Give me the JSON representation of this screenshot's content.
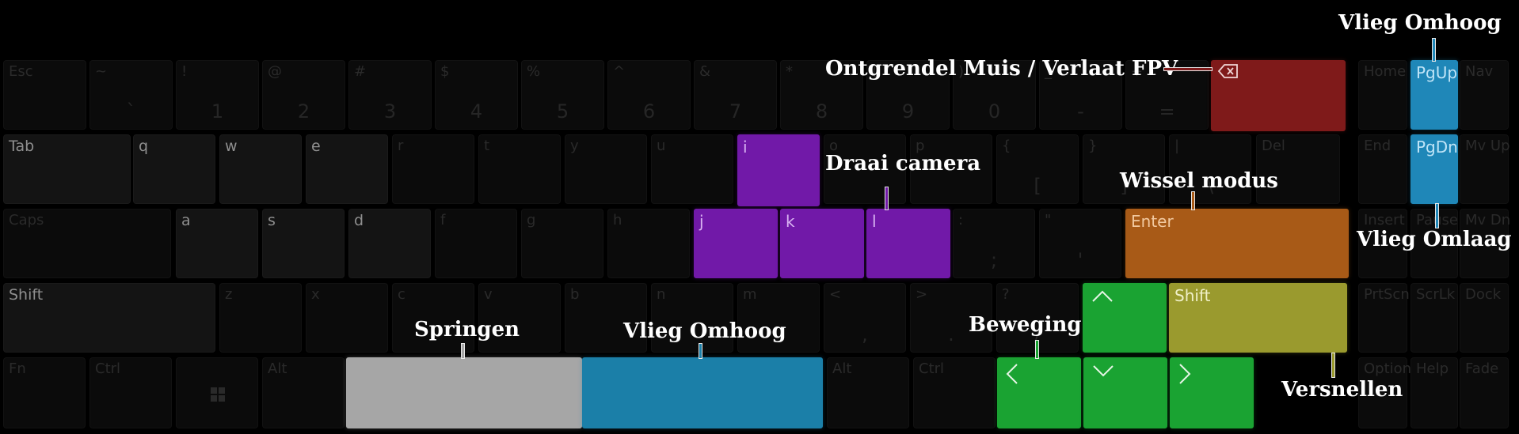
{
  "keyboard": {
    "rows": [
      [
        {
          "id": "esc",
          "top": "Esc"
        },
        {
          "id": "backtick",
          "top": "~",
          "bottom": "`"
        },
        {
          "id": "1",
          "top": "!",
          "bottom": "1"
        },
        {
          "id": "2",
          "top": "@",
          "bottom": "2"
        },
        {
          "id": "3",
          "top": "#",
          "bottom": "3"
        },
        {
          "id": "4",
          "top": "$",
          "bottom": "4"
        },
        {
          "id": "5",
          "top": "%",
          "bottom": "5"
        },
        {
          "id": "6",
          "top": "^",
          "bottom": "6"
        },
        {
          "id": "7",
          "top": "&",
          "bottom": "7"
        },
        {
          "id": "8",
          "top": "*",
          "bottom": "8"
        },
        {
          "id": "9",
          "top": "(",
          "bottom": "9"
        },
        {
          "id": "0",
          "top": ")",
          "bottom": "0"
        },
        {
          "id": "minus",
          "top": "_",
          "bottom": "-"
        },
        {
          "id": "equals",
          "top": "+",
          "bottom": "="
        },
        {
          "id": "backspace",
          "icon": "backspace-icon",
          "lit": true,
          "color": "#7f1a1a"
        },
        {
          "id": "home",
          "top": "Home"
        },
        {
          "id": "pgup",
          "top": "PgUp",
          "lit": true,
          "color": "#1f87b8",
          "textcolor": "#bfe4f7"
        },
        {
          "id": "nav",
          "top": "Nav"
        }
      ],
      [
        {
          "id": "tab",
          "top": "Tab",
          "dark": true
        },
        {
          "id": "q",
          "top": "q",
          "dark": true
        },
        {
          "id": "w",
          "top": "w",
          "dark": true
        },
        {
          "id": "e",
          "top": "e",
          "dark": true
        },
        {
          "id": "r",
          "top": "r"
        },
        {
          "id": "t",
          "top": "t"
        },
        {
          "id": "y",
          "top": "y"
        },
        {
          "id": "u",
          "top": "u"
        },
        {
          "id": "i",
          "top": "i",
          "lit": true,
          "color": "#7119a8",
          "textcolor": "#d9b3f2"
        },
        {
          "id": "o",
          "top": "o"
        },
        {
          "id": "p",
          "top": "p"
        },
        {
          "id": "lbracket",
          "top": "{",
          "bottom": "["
        },
        {
          "id": "rbracket",
          "top": "}",
          "bottom": "]"
        },
        {
          "id": "backslash",
          "top": "|",
          "bottom": "\\"
        },
        {
          "id": "del",
          "top": "Del"
        },
        {
          "id": "end",
          "top": "End"
        },
        {
          "id": "pgdn",
          "top": "PgDn",
          "lit": true,
          "color": "#1f87b8",
          "textcolor": "#bfe4f7"
        },
        {
          "id": "mvup",
          "top": "Mv Up"
        }
      ],
      [
        {
          "id": "caps",
          "top": "Caps"
        },
        {
          "id": "a",
          "top": "a",
          "dark": true
        },
        {
          "id": "s",
          "top": "s",
          "dark": true
        },
        {
          "id": "d",
          "top": "d",
          "dark": true
        },
        {
          "id": "f",
          "top": "f"
        },
        {
          "id": "g",
          "top": "g"
        },
        {
          "id": "h",
          "top": "h"
        },
        {
          "id": "j",
          "top": "j",
          "lit": true,
          "color": "#7119a8",
          "textcolor": "#d9b3f2"
        },
        {
          "id": "k",
          "top": "k",
          "lit": true,
          "color": "#7119a8",
          "textcolor": "#d9b3f2"
        },
        {
          "id": "l",
          "top": "l",
          "lit": true,
          "color": "#7119a8",
          "textcolor": "#d9b3f2"
        },
        {
          "id": "semicolon",
          "top": ":",
          "bottom": ";"
        },
        {
          "id": "quote",
          "top": "\"",
          "bottom": "'"
        },
        {
          "id": "enter",
          "top": "Enter",
          "lit": true,
          "color": "#a85a17",
          "textcolor": "#f2c9a0"
        },
        {
          "id": "insert",
          "top": "Insert"
        },
        {
          "id": "pause",
          "top": "Pause"
        },
        {
          "id": "mvdn",
          "top": "Mv Dn"
        }
      ],
      [
        {
          "id": "lshift",
          "top": "Shift",
          "dark": true
        },
        {
          "id": "z",
          "top": "z"
        },
        {
          "id": "x",
          "top": "x"
        },
        {
          "id": "c",
          "top": "c"
        },
        {
          "id": "v",
          "top": "v"
        },
        {
          "id": "b",
          "top": "b"
        },
        {
          "id": "n",
          "top": "n"
        },
        {
          "id": "m",
          "top": "m"
        },
        {
          "id": "comma",
          "top": "<",
          "bottom": ","
        },
        {
          "id": "period",
          "top": ">",
          "bottom": "."
        },
        {
          "id": "slash",
          "top": "?",
          "bottom": "/"
        },
        {
          "id": "up",
          "icon": "chevron-up-icon",
          "lit": true,
          "color": "#1aa332"
        },
        {
          "id": "rshift",
          "top": "Shift",
          "lit": true,
          "color": "#9a9a2e",
          "textcolor": "#f0f0c8"
        },
        {
          "id": "prtscn",
          "top": "PrtScn"
        },
        {
          "id": "scrlk",
          "top": "ScrLk"
        },
        {
          "id": "dock",
          "top": "Dock"
        }
      ],
      [
        {
          "id": "fn",
          "top": "Fn"
        },
        {
          "id": "lctrl",
          "top": "Ctrl"
        },
        {
          "id": "win",
          "icon": "windows-logo-icon"
        },
        {
          "id": "lalt",
          "top": "Alt"
        },
        {
          "id": "space_left",
          "lit": true,
          "color": "#a6a6a6"
        },
        {
          "id": "space_right",
          "lit": true,
          "color": "#1b7fa8"
        },
        {
          "id": "ralt",
          "top": "Alt"
        },
        {
          "id": "rctrl",
          "top": "Ctrl"
        },
        {
          "id": "left",
          "icon": "chevron-left-icon",
          "lit": true,
          "color": "#1aa332"
        },
        {
          "id": "down",
          "icon": "chevron-down-icon",
          "lit": true,
          "color": "#1aa332"
        },
        {
          "id": "right",
          "icon": "chevron-right-icon",
          "lit": true,
          "color": "#1aa332"
        },
        {
          "id": "options",
          "top": "Options"
        },
        {
          "id": "help",
          "top": "Help"
        },
        {
          "id": "fade",
          "top": "Fade"
        }
      ]
    ]
  },
  "labels": [
    {
      "id": "vlieg-omhoog-top",
      "text": "Vlieg Omhoog",
      "color": "#1f87b8"
    },
    {
      "id": "ontgrendel",
      "text": "Ontgrendel Muis / Verlaat FPV",
      "color": "#7f1a1a"
    },
    {
      "id": "draai-camera",
      "text": "Draai camera",
      "color": "#7119a8"
    },
    {
      "id": "wissel-modus",
      "text": "Wissel modus",
      "color": "#a85a17"
    },
    {
      "id": "vlieg-omlaag",
      "text": "Vlieg Omlaag",
      "color": "#1f87b8"
    },
    {
      "id": "springen",
      "text": "Springen",
      "color": "#a6a6a6"
    },
    {
      "id": "vlieg-omhoog-space",
      "text": "Vlieg Omhoog",
      "color": "#1b7fa8"
    },
    {
      "id": "beweging",
      "text": "Beweging",
      "color": "#1aa332"
    },
    {
      "id": "versnellen",
      "text": "Versnellen",
      "color": "#9a9a2e"
    }
  ]
}
